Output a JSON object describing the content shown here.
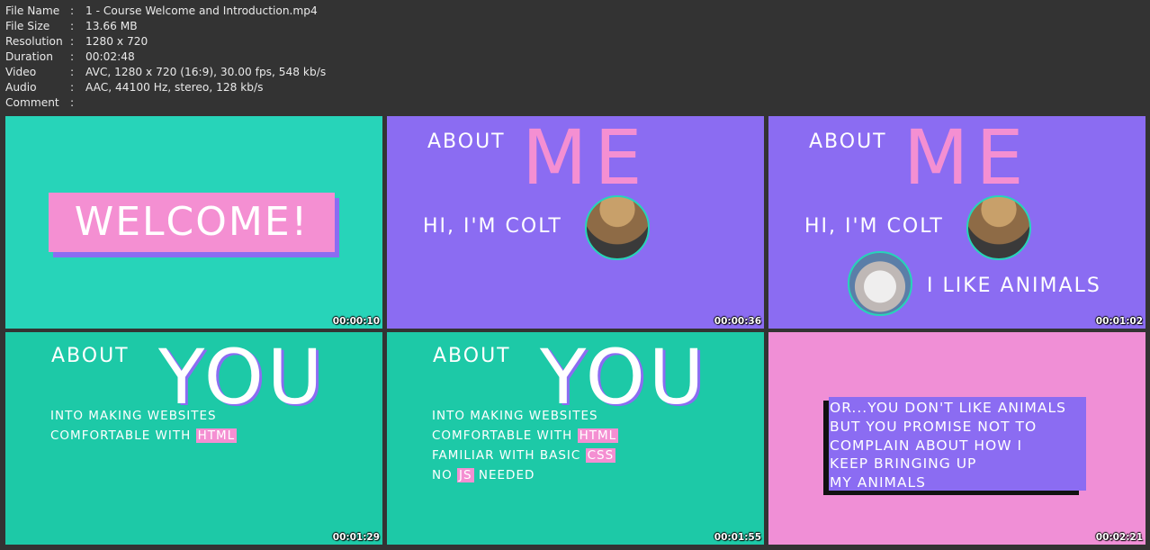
{
  "info": {
    "rows": [
      {
        "label": "File Name",
        "value": "1 - Course Welcome and Introduction.mp4"
      },
      {
        "label": "File Size",
        "value": "13.66 MB"
      },
      {
        "label": "Resolution",
        "value": "1280 x 720"
      },
      {
        "label": "Duration",
        "value": "00:02:48"
      },
      {
        "label": "Video",
        "value": "AVC, 1280 x 720 (16:9), 30.00 fps, 548 kb/s"
      },
      {
        "label": "Audio",
        "value": "AAC, 44100 Hz, stereo, 128 kb/s"
      },
      {
        "label": "Comment",
        "value": ""
      }
    ],
    "separator": ":"
  },
  "thumbs": [
    {
      "timestamp": "00:00:10",
      "welcome": "WELCOME!"
    },
    {
      "timestamp": "00:00:36",
      "about": "ABOUT",
      "big": "ME",
      "hi": "HI, I'M COLT"
    },
    {
      "timestamp": "00:01:02",
      "about": "ABOUT",
      "big": "ME",
      "hi": "HI, I'M COLT",
      "likes": "I LIKE ANIMALS"
    },
    {
      "timestamp": "00:01:29",
      "about": "ABOUT",
      "big": "YOU",
      "line1": "INTO MAKING WEBSITES",
      "line2a": "COMFORTABLE WITH",
      "line2b": "HTML"
    },
    {
      "timestamp": "00:01:55",
      "about": "ABOUT",
      "big": "YOU",
      "line1": "INTO MAKING WEBSITES",
      "line2a": "COMFORTABLE WITH",
      "line2b": "HTML",
      "line3a": "FAMILIAR WITH BASIC",
      "line3b": "CSS",
      "line4a": "NO",
      "line4b": "JS",
      "line4c": "NEEDED"
    },
    {
      "timestamp": "00:02:21",
      "quote": [
        "OR...YOU DON'T LIKE ANIMALS",
        "BUT YOU PROMISE NOT TO",
        "COMPLAIN ABOUT HOW I",
        "KEEP BRINGING UP",
        "MY ANIMALS"
      ]
    }
  ],
  "colors": {
    "background": "#333333",
    "teal": "#27d4b9",
    "purple": "#8b6cf2",
    "pink": "#f48fd2"
  }
}
